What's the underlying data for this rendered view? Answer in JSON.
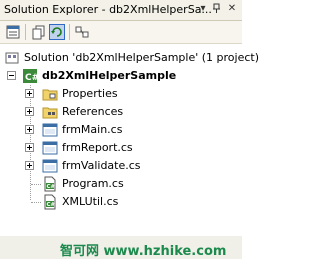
{
  "window": {
    "title": "Solution Explorer - db2XmlHelperSa..."
  },
  "tree": {
    "solution": "Solution 'db2XmlHelperSample' (1 project)",
    "project": "db2XmlHelperSample",
    "items": [
      {
        "label": "Properties"
      },
      {
        "label": "References"
      },
      {
        "label": "frmMain.cs"
      },
      {
        "label": "frmReport.cs"
      },
      {
        "label": "frmValidate.cs"
      },
      {
        "label": "Program.cs"
      },
      {
        "label": "XMLUtil.cs"
      }
    ]
  },
  "watermark": {
    "text": "智可网 www.hzhike.com"
  }
}
